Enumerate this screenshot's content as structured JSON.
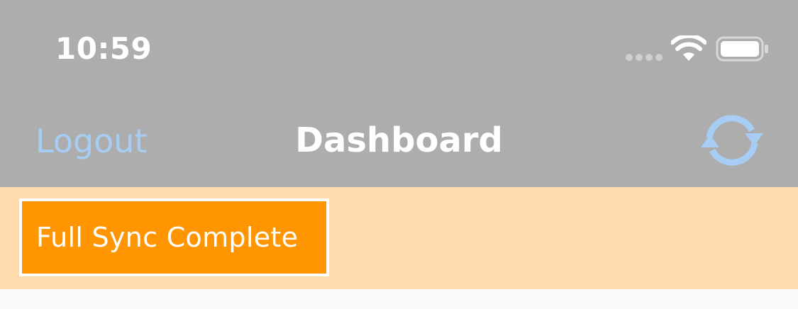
{
  "status_bar": {
    "time": "10:59",
    "icons": [
      "signal-icon",
      "wifi-icon",
      "battery-icon"
    ]
  },
  "nav_bar": {
    "logout_label": "Logout",
    "title": "Dashboard",
    "sync_icon": "refresh-icon"
  },
  "banner": {
    "status_text": "Full Sync Complete"
  },
  "colors": {
    "bar_background": "#adadad",
    "link": "#a7cdf4",
    "banner_background": "#fddbaf",
    "badge_background": "#ff9500",
    "content_background": "#f9f9f9"
  }
}
